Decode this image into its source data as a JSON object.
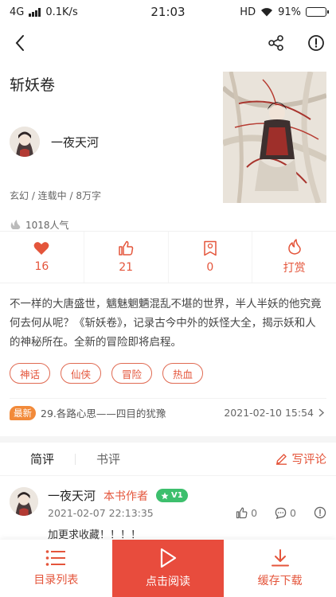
{
  "status_bar": {
    "network": "4G",
    "speed": "0.1K/s",
    "time": "21:03",
    "hd": "HD",
    "battery": "91%",
    "battery_level": 0.91
  },
  "book": {
    "title": "斩妖卷",
    "author": "一夜天河",
    "meta": "玄幻 / 连载中 / 8万字",
    "popularity": "1018人气"
  },
  "actions": [
    {
      "icon": "heart-icon",
      "label": "16"
    },
    {
      "icon": "thumbs-up-icon",
      "label": "21"
    },
    {
      "icon": "bookmark-ribbon-icon",
      "label": "0"
    },
    {
      "icon": "flame-icon",
      "label": "打赏"
    }
  ],
  "synopsis": "不一样的大唐盛世，魑魅魍魉混乱不堪的世界，半人半妖的他究竟何去何从呢？《斩妖卷》，记录古今中外的妖怪大全，揭示妖和人的神秘所在。全新的冒险即将启程。",
  "tags": [
    "神话",
    "仙侠",
    "冒险",
    "热血"
  ],
  "latest": {
    "badge": "最新",
    "chapter": "29.各路心思——四目的犹豫",
    "date": "2021-02-10 15:54"
  },
  "comments_section": {
    "tabs": [
      "简评",
      "书评"
    ],
    "write_label": "写评论"
  },
  "comment": {
    "user": "一夜天河",
    "role": "本书作者",
    "badge": "V1",
    "time": "2021-02-07 22:13:35",
    "likes": "0",
    "replies": "0",
    "text": "加更求收藏！！！！"
  },
  "bottom_bar": {
    "toc": "目录列表",
    "read": "点击阅读",
    "download": "缓存下载"
  },
  "colors": {
    "accent": "#e4553b",
    "primary_button": "#e84c3d",
    "latest_badge": "#f28a3a",
    "level_badge": "#3dbf6d"
  }
}
